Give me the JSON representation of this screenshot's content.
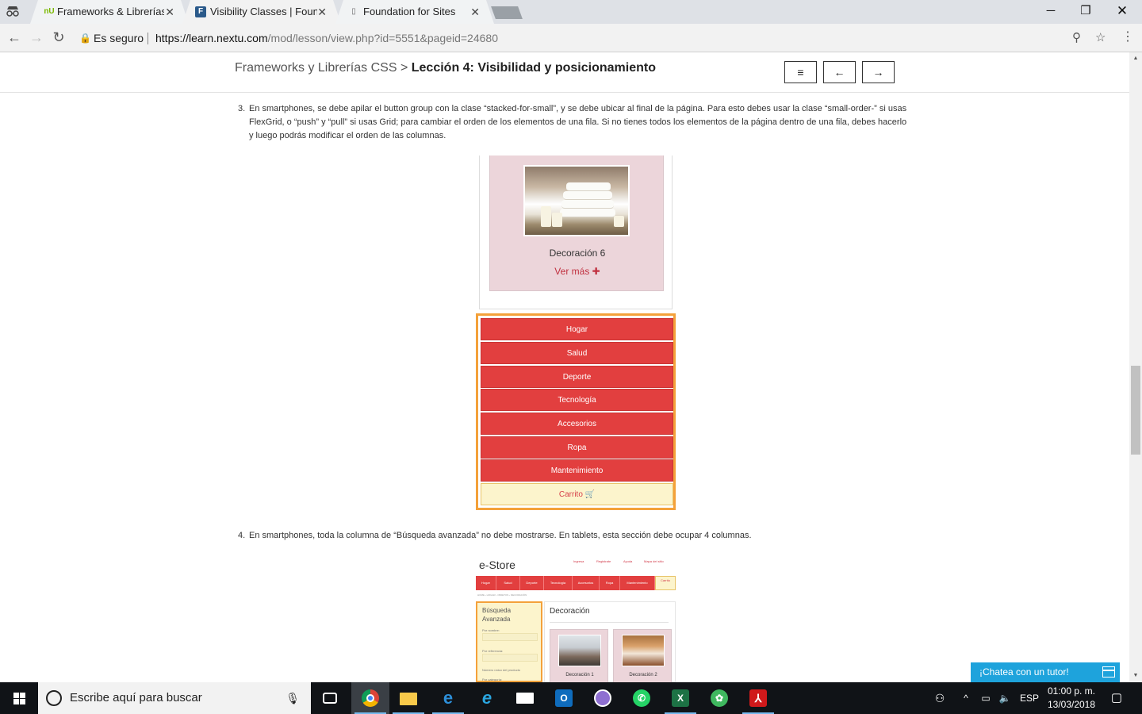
{
  "browser": {
    "tabs": [
      {
        "favicon": "nU",
        "title": "Frameworks & Librerías C",
        "favicon_color": "#7ab800"
      },
      {
        "favicon": "F",
        "title": "Visibility Classes | Found",
        "favicon_color": "#2b5a8a"
      },
      {
        "favicon": "▯",
        "title": "Foundation for Sites",
        "favicon_color": "#666666"
      }
    ],
    "security_label": "Es seguro",
    "url_host": "https://learn.nextu.com",
    "url_path": "/mod/lesson/view.php?id=5551&pageid=24680"
  },
  "lesson": {
    "course": "Frameworks y Librerías CSS",
    "separator": ">",
    "title": "Lección 4: Visibilidad y posicionamiento",
    "menu_button": "≡",
    "prev_button": "←",
    "next_button": "→"
  },
  "content": {
    "step3_num": "3.",
    "step3_text": "En smartphones, se debe apilar el button group con la clase “stacked-for-small”, y se debe ubicar al final de la página. Para esto debes usar la clase “small-order-” si usas FlexGrid, o “push” y “pull” si usas Grid; para cambiar el orden de los elementos de una fila. Si no tienes todos los elementos de la página dentro de una fila, debes hacerlo y luego podrás modificar el orden de las columnas.",
    "step4_num": "4.",
    "step4_text": "En smartphones, toda la columna de “Búsqueda avanzada” no debe mostrarse. En tablets, esta sección debe ocupar 4 columnas."
  },
  "mockup1": {
    "product_title": "Decoración 6",
    "product_link": "Ver más ✚",
    "menu_items": [
      "Hogar",
      "Salud",
      "Deporte",
      "Tecnología",
      "Accesorios",
      "Ropa",
      "Mantenimiento"
    ],
    "cart_label": "Carrito 🛒"
  },
  "mockup2": {
    "logo": "e-Store",
    "top_links": [
      "Ingresa",
      "Registrate",
      "Ayuda",
      "Mapa del sitio"
    ],
    "nav_items": [
      "Hogar",
      "Salud",
      "Deporte",
      "Tecnología",
      "Accesorios",
      "Ropa",
      "Mantenimiento"
    ],
    "cart_label": "Carrito",
    "breadcrumb": "HOME › HOGAR › OBJETOS › DECORACIÓN",
    "sidebar_title": "Búsqueda Avanzada",
    "sidebar_fields": [
      "Por nombre:",
      "Por referencia:",
      "Número único del producto",
      "Por categoría:"
    ],
    "main_title": "Decoración",
    "products": [
      "Decoración 1",
      "Decoración 2"
    ]
  },
  "chat": {
    "label": "¡Chatea con un tutor!"
  },
  "taskbar": {
    "search_placeholder": "Escribe aquí para buscar",
    "language": "ESP",
    "time": "01:00 p. m.",
    "date": "13/03/2018",
    "apps": [
      "task-view",
      "chrome",
      "file-explorer",
      "edge",
      "internet-explorer",
      "mail",
      "outlook",
      "app-purple",
      "whatsapp",
      "excel",
      "app-green",
      "acrobat"
    ]
  },
  "colors": {
    "accent_red": "#e23f3f",
    "accent_orange": "#f4a13a",
    "chat_blue": "#1ea3dc",
    "card_pink": "#ecd5da"
  }
}
